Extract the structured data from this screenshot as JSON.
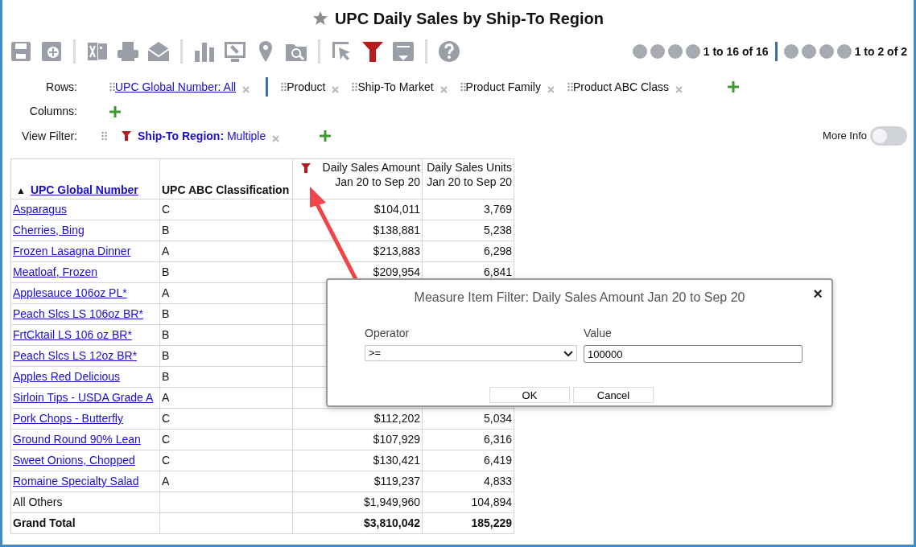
{
  "title": "UPC Daily Sales by Ship-To Region",
  "pager": {
    "rows_text": "1 to 16 of 16",
    "cols_text": "1 to 2 of 2"
  },
  "rows_bar": {
    "label": "Rows:",
    "fields": [
      {
        "label": "UPC Global Number: All",
        "kind": "link"
      },
      {
        "label": "Product",
        "kind": "plain"
      },
      {
        "label": "Ship-To Market",
        "kind": "plain"
      },
      {
        "label": "Product Family",
        "kind": "plain"
      },
      {
        "label": "Product ABC Class",
        "kind": "plain"
      }
    ]
  },
  "columns_bar": {
    "label": "Columns:"
  },
  "view_filter": {
    "label": "View Filter:",
    "field": "Ship-To Region:",
    "value": "Multiple"
  },
  "more_info": {
    "label": "More Info",
    "on": false
  },
  "table": {
    "sort_mark": "▲",
    "columns": [
      {
        "lines": [
          "UPC Global Number"
        ],
        "kind": "link"
      },
      {
        "lines": [
          "UPC ABC Classification"
        ],
        "kind": "bold"
      },
      {
        "lines": [
          "Daily Sales Amount",
          "Jan 20 to Sep 20"
        ],
        "kind": "measure",
        "filtered": true
      },
      {
        "lines": [
          "Daily Sales Units",
          "Jan 20 to Sep 20"
        ],
        "kind": "measure",
        "filtered": false
      }
    ],
    "rows": [
      {
        "kind": "link",
        "cells": [
          "Asparagus",
          "C",
          "$104,011",
          "3,769"
        ]
      },
      {
        "kind": "link",
        "cells": [
          "Cherries, Bing",
          "B",
          "$138,881",
          "5,238"
        ]
      },
      {
        "kind": "link",
        "cells": [
          "Frozen Lasagna Dinner",
          "A",
          "$213,883",
          "6,298"
        ]
      },
      {
        "kind": "link",
        "cells": [
          "Meatloaf, Frozen",
          "B",
          "$209,954",
          "6,841"
        ]
      },
      {
        "kind": "link",
        "cells": [
          "Applesauce 106oz PL*",
          "A",
          "",
          ""
        ]
      },
      {
        "kind": "link",
        "cells": [
          "Peach Slcs LS 106oz BR*",
          "B",
          "",
          ""
        ]
      },
      {
        "kind": "link",
        "cells": [
          "FrtCktail LS 106 oz BR*",
          "B",
          "",
          ""
        ]
      },
      {
        "kind": "link",
        "cells": [
          "Peach Slcs LS 12oz BR*",
          "B",
          "",
          ""
        ]
      },
      {
        "kind": "link",
        "cells": [
          "Apples Red Delicious",
          "B",
          "",
          ""
        ]
      },
      {
        "kind": "link",
        "cells": [
          "Sirloin Tips - USDA Grade A",
          "A",
          "",
          ""
        ]
      },
      {
        "kind": "link",
        "cells": [
          "Pork Chops - Butterfly",
          "C",
          "$112,202",
          "5,034"
        ]
      },
      {
        "kind": "link",
        "cells": [
          "Ground Round 90% Lean",
          "C",
          "$107,929",
          "6,316"
        ]
      },
      {
        "kind": "link",
        "cells": [
          "Sweet Onions, Chopped",
          "C",
          "$130,421",
          "6,419"
        ]
      },
      {
        "kind": "link",
        "cells": [
          "Romaine Specialty Salad",
          "A",
          "$119,237",
          "4,833"
        ]
      },
      {
        "kind": "plain",
        "cells": [
          "All Others",
          "",
          "$1,949,960",
          "104,894"
        ]
      },
      {
        "kind": "total",
        "cells": [
          "Grand Total",
          "",
          "$3,810,042",
          "185,229"
        ]
      }
    ]
  },
  "dialog": {
    "title": "Measure Item Filter: Daily Sales Amount Jan 20 to Sep 20",
    "close": "×",
    "operator_label": "Operator",
    "operator": ">=",
    "value_label": "Value",
    "value": "100000",
    "buttons": [
      "OK",
      "Cancel"
    ]
  }
}
